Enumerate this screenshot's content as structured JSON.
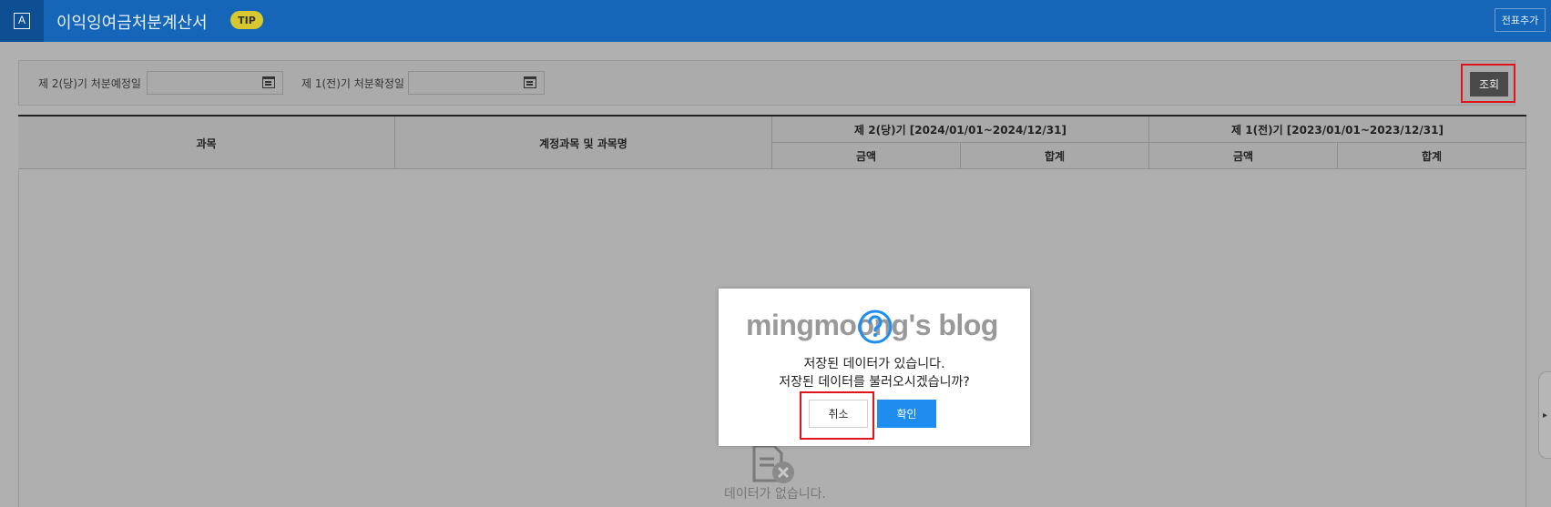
{
  "header": {
    "app_icon_letter": "A",
    "title": "이익잉여금처분계산서",
    "tip_label": "TIP",
    "add_voucher_label": "전표추가"
  },
  "filters": {
    "current_disposal_label": "제 2(당)기  처분예정일",
    "previous_disposal_label": "제 1(전)기  처분확정일",
    "current_disposal_value": "",
    "previous_disposal_value": ""
  },
  "search_button_label": "조회",
  "table": {
    "headers": {
      "subject": "과목",
      "account_name": "계정과목 및 과목명",
      "current_period": "제 2(당)기 [2024/01/01~2024/12/31]",
      "previous_period": "제 1(전)기 [2023/01/01~2023/12/31]",
      "amount": "금액",
      "total": "합계"
    },
    "empty_message": "데이터가 없습니다."
  },
  "dialog": {
    "watermark": "mingmoong's blog",
    "line1": "저장된 데이터가 있습니다.",
    "line2": "저장된 데이터를 불러오시겠습니까?",
    "cancel_label": "취소",
    "ok_label": "확인"
  },
  "side_handle_glyph": "▸",
  "colors": {
    "header_bg": "#1565b8",
    "accent": "#1f8cf0",
    "highlight_border": "#e0141a",
    "tip_badge": "#d7c82f"
  }
}
